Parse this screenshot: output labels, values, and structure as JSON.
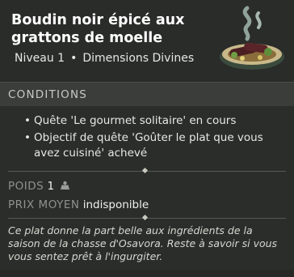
{
  "item": {
    "name": "Boudin noir épicé aux grattons de moelle",
    "level": "Niveau 1",
    "separator": "•",
    "category": "Dimensions Divines",
    "icon": "food-plate-icon"
  },
  "conditions": {
    "header": "CONDITIONS",
    "items": [
      "Quête 'Le gourmet solitaire' en cours",
      "Objectif de quête 'Goûter le plat que vous avez cuisiné' achevé"
    ]
  },
  "stats": {
    "weight_label": "POIDS",
    "weight_value": "1",
    "weight_icon": "weight-icon",
    "price_label": "PRIX MOYEN",
    "price_value": "indisponible"
  },
  "description": "Ce plat donne la part belle aux ingrédients de la saison de la chasse d'Osavora. Reste à savoir si vous vous sentez prêt à l'ingurgiter."
}
